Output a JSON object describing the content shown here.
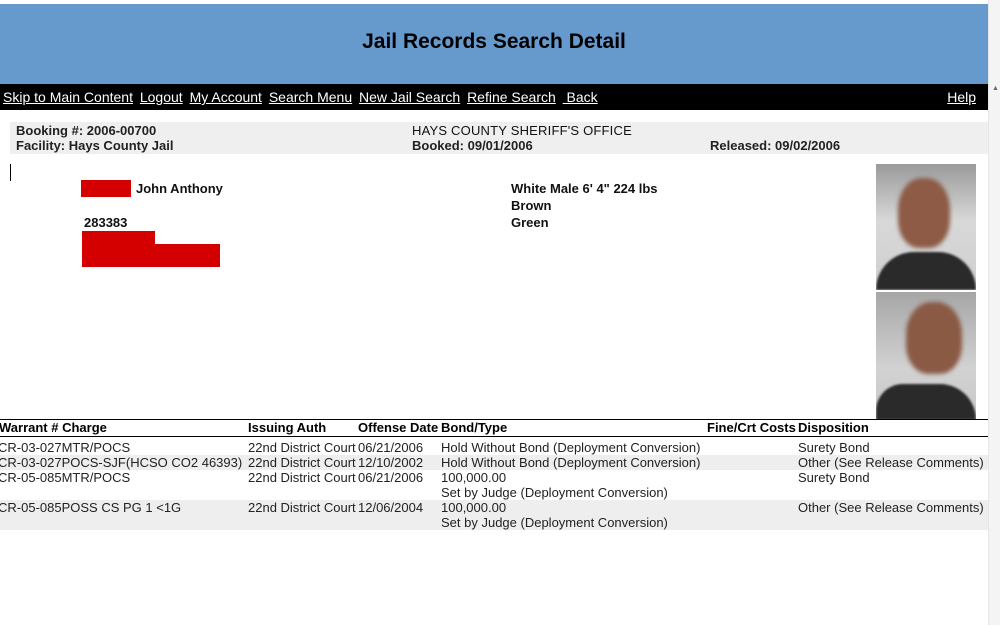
{
  "page": {
    "title": "Jail Records Search Detail"
  },
  "nav": {
    "links": [
      "Skip to Main Content",
      "Logout",
      "My Account",
      "Search Menu",
      "New Jail Search",
      "Refine Search",
      " Back"
    ],
    "help": "Help"
  },
  "booking": {
    "booking_no": "Booking #: 2006-00700",
    "facility": "Facility: Hays County Jail",
    "office": "HAYS COUNTY SHERIFF'S OFFICE",
    "booked": "Booked: 09/01/2006",
    "released": "Released: 09/02/2006"
  },
  "inmate": {
    "name": "John Anthony",
    "id": "283383",
    "description": "White  Male  6' 4\"   224 lbs",
    "hair": "Brown",
    "eyes": "Green"
  },
  "table": {
    "headers": {
      "warrant_charge": "Warrant # Charge",
      "issuing_auth": "Issuing Auth",
      "offense_date": "Offense Date",
      "bond_type": "Bond/Type",
      "fine_costs": "Fine/Crt Costs",
      "disposition": "Disposition"
    },
    "rows": [
      {
        "charge": "CR-03-027MTR/POCS",
        "auth": "22nd District Court",
        "date": "06/21/2006",
        "bond": "Hold Without Bond (Deployment Conversion)",
        "bond2": "",
        "disposition": "Surety Bond"
      },
      {
        "charge": "CR-03-027POCS-SJF(HCSO CO2 46393)",
        "auth": "22nd District Court",
        "date": "12/10/2002",
        "bond": "Hold Without Bond (Deployment Conversion)",
        "bond2": "",
        "disposition": "Other (See Release Comments)"
      },
      {
        "charge": "CR-05-085MTR/POCS",
        "auth": "22nd District Court",
        "date": "06/21/2006",
        "bond": "100,000.00",
        "bond2": "Set by Judge (Deployment Conversion)",
        "disposition": "Surety Bond"
      },
      {
        "charge": "CR-05-085POSS CS PG 1 <1G",
        "auth": "22nd District Court",
        "date": "12/06/2004",
        "bond": "100,000.00",
        "bond2": "Set by Judge (Deployment Conversion)",
        "disposition": "Other (See Release Comments)"
      }
    ]
  },
  "colors": {
    "header_band": "#6699cc",
    "navbar": "#000000",
    "redaction": "#d40000",
    "row_alt": "#eeeeee"
  }
}
